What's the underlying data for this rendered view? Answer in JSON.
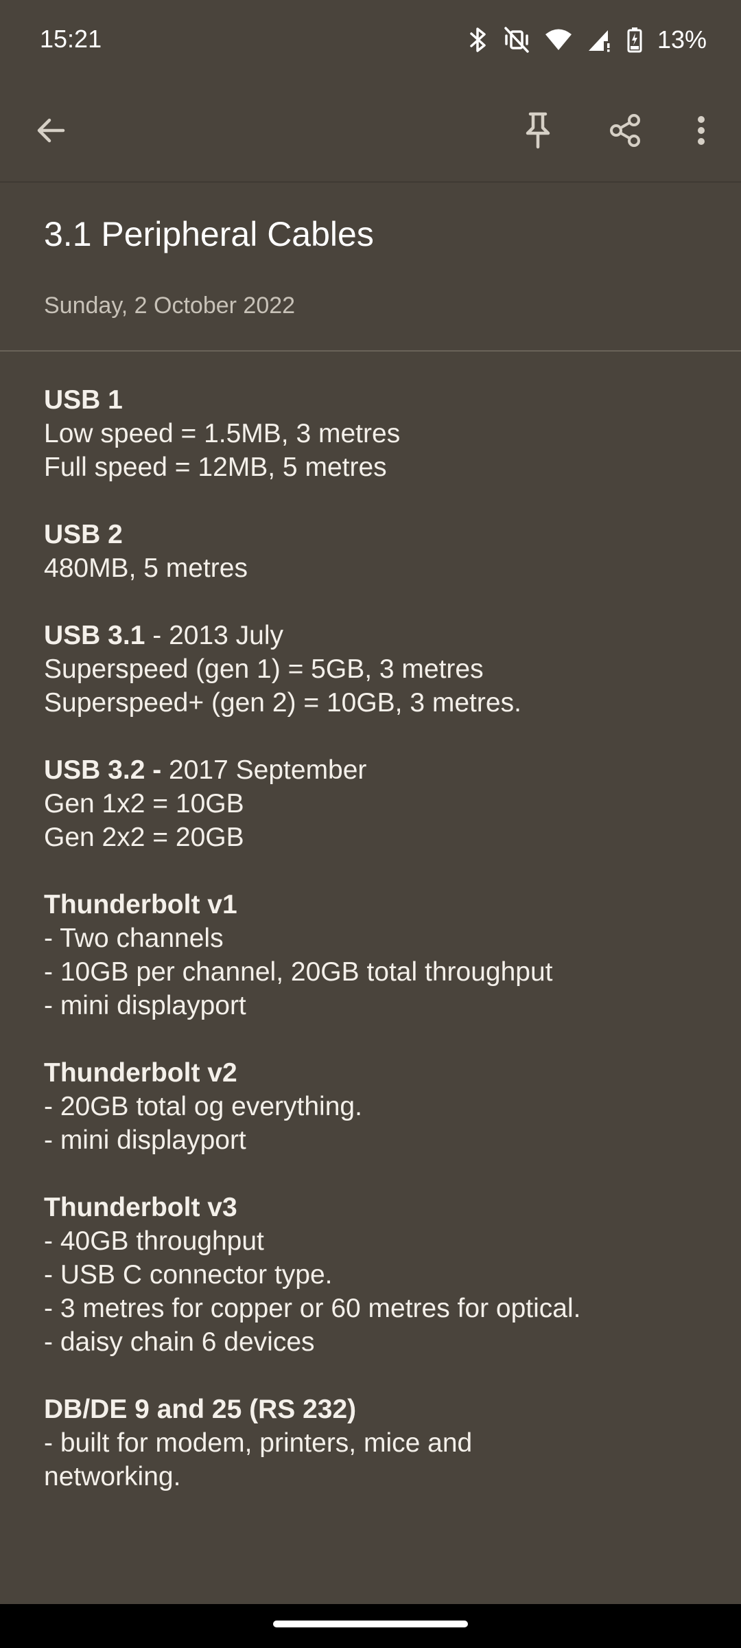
{
  "status_bar": {
    "time": "15:21",
    "battery": "13%",
    "icons": [
      "bluetooth-icon",
      "mute-vibrate-icon",
      "wifi-icon",
      "signal-icon",
      "battery-charging-icon"
    ]
  },
  "toolbar": {
    "back_icon": "arrow-left-icon",
    "pin_icon": "pin-icon",
    "share_icon": "share-icon",
    "more_icon": "more-vert-icon"
  },
  "note": {
    "title": "3.1 Peripheral Cables",
    "date": "Sunday, 2 October 2022",
    "sections": [
      {
        "heading": "USB 1",
        "heading_suffix": "",
        "lines": [
          "Low speed = 1.5MB, 3 metres",
          "Full speed = 12MB, 5 metres"
        ]
      },
      {
        "heading": "USB 2",
        "heading_suffix": "",
        "lines": [
          "480MB, 5 metres"
        ]
      },
      {
        "heading": "USB 3.1",
        "heading_suffix": " - 2013 July",
        "lines": [
          "Superspeed (gen 1) = 5GB, 3 metres",
          "Superspeed+ (gen 2) = 10GB, 3 metres."
        ]
      },
      {
        "heading": "USB 3.2 -",
        "heading_suffix": " 2017 September",
        "lines": [
          "Gen 1x2 = 10GB",
          "Gen 2x2 = 20GB"
        ]
      },
      {
        "heading": "Thunderbolt v1",
        "heading_suffix": "",
        "lines": [
          "- Two channels",
          "- 10GB per channel, 20GB total throughput",
          "- mini displayport"
        ]
      },
      {
        "heading": "Thunderbolt v2",
        "heading_suffix": "",
        "lines": [
          "- 20GB total og everything.",
          "- mini displayport"
        ]
      },
      {
        "heading": "Thunderbolt v3",
        "heading_suffix": "",
        "lines": [
          "- 40GB throughput",
          "- USB C connector type.",
          "- 3 metres for copper or 60 metres for optical.",
          "- daisy chain 6 devices"
        ]
      },
      {
        "heading": "DB/DE 9 and 25 (RS 232)",
        "heading_suffix": "",
        "lines": [
          "- built for modem, printers, mice and networking."
        ]
      }
    ]
  },
  "colors": {
    "background": "#4a443c",
    "text": "#f4f0ea",
    "muted_text": "#c8c2b8",
    "divider": "#6a6359"
  }
}
